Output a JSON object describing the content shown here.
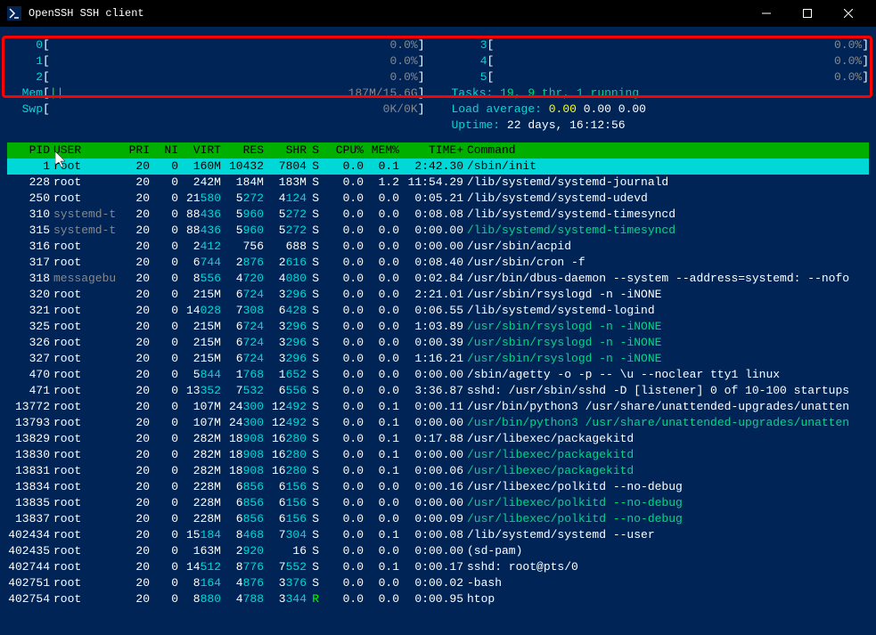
{
  "window": {
    "title": "OpenSSH SSH client"
  },
  "cpu_meters_left": [
    {
      "idx": "0",
      "pct": "0.0%"
    },
    {
      "idx": "1",
      "pct": "0.0%"
    },
    {
      "idx": "2",
      "pct": "0.0%"
    }
  ],
  "cpu_meters_right": [
    {
      "idx": "3",
      "pct": "0.0%"
    },
    {
      "idx": "4",
      "pct": "0.0%"
    },
    {
      "idx": "5",
      "pct": "0.0%"
    }
  ],
  "mem": {
    "label": "Mem",
    "fill": "||",
    "value": "187M/15.6G"
  },
  "swp": {
    "label": "Swp",
    "value": "0K/0K"
  },
  "tasks": {
    "label": "Tasks: ",
    "values": "19, 9 thr, 1 running"
  },
  "load": {
    "label": "Load average: ",
    "v1": "0.00",
    "v2": "0.00",
    "v3": "0.00"
  },
  "uptime": {
    "label": "Uptime: ",
    "value": "22 days, 16:12:56"
  },
  "headers": {
    "pid": "PID",
    "user": "USER",
    "pri": "PRI",
    "ni": "NI",
    "virt": "VIRT",
    "res": "RES",
    "shr": "SHR",
    "s": "S",
    "cpu": "CPU%",
    "mem": "MEM%",
    "time": "TIME+",
    "cmd": "Command"
  },
  "processes": [
    {
      "pid": "1",
      "user": "root",
      "pri": "20",
      "ni": "0",
      "virt": "160M",
      "res": "10432",
      "shr": "7804",
      "s": "S",
      "cpu": "0.0",
      "mem": "0.1",
      "time": "2:42.30",
      "cmd": "/sbin/init",
      "sel": true
    },
    {
      "pid": "228",
      "user": "root",
      "pri": "20",
      "ni": "0",
      "virt": "242M",
      "res": "184M",
      "shr": "183M",
      "s": "S",
      "cpu": "0.0",
      "mem": "1.2",
      "time": "11:54.29",
      "cmd": "/lib/systemd/systemd-journald"
    },
    {
      "pid": "250",
      "user": "root",
      "pri": "20",
      "ni": "0",
      "virt": "21580",
      "res": "5272",
      "shr": "4124",
      "s": "S",
      "cpu": "0.0",
      "mem": "0.0",
      "time": "0:05.21",
      "cmd": "/lib/systemd/systemd-udevd"
    },
    {
      "pid": "310",
      "user": "systemd-t",
      "dimuser": true,
      "pri": "20",
      "ni": "0",
      "virt": "88436",
      "res": "5960",
      "shr": "5272",
      "s": "S",
      "cpu": "0.0",
      "mem": "0.0",
      "time": "0:08.08",
      "cmd": "/lib/systemd/systemd-timesyncd"
    },
    {
      "pid": "315",
      "user": "systemd-t",
      "dimuser": true,
      "pri": "20",
      "ni": "0",
      "virt": "88436",
      "res": "5960",
      "shr": "5272",
      "s": "S",
      "cpu": "0.0",
      "mem": "0.0",
      "time": "0:00.00",
      "cmd": "/lib/systemd/systemd-timesyncd",
      "cmddim": true
    },
    {
      "pid": "316",
      "user": "root",
      "pri": "20",
      "ni": "0",
      "virt": "2412",
      "res": "756",
      "shr": "688",
      "s": "S",
      "cpu": "0.0",
      "mem": "0.0",
      "time": "0:00.00",
      "cmd": "/usr/sbin/acpid"
    },
    {
      "pid": "317",
      "user": "root",
      "pri": "20",
      "ni": "0",
      "virt": "6744",
      "res": "2876",
      "shr": "2616",
      "s": "S",
      "cpu": "0.0",
      "mem": "0.0",
      "time": "0:08.40",
      "cmd": "/usr/sbin/cron -f"
    },
    {
      "pid": "318",
      "user": "messagebu",
      "dimuser": true,
      "pri": "20",
      "ni": "0",
      "virt": "8556",
      "res": "4720",
      "shr": "4080",
      "s": "S",
      "cpu": "0.0",
      "mem": "0.0",
      "time": "0:02.84",
      "cmd": "/usr/bin/dbus-daemon --system --address=systemd: --nofo"
    },
    {
      "pid": "320",
      "user": "root",
      "pri": "20",
      "ni": "0",
      "virt": "215M",
      "res": "6724",
      "shr": "3296",
      "s": "S",
      "cpu": "0.0",
      "mem": "0.0",
      "time": "2:21.01",
      "cmd": "/usr/sbin/rsyslogd -n -iNONE"
    },
    {
      "pid": "321",
      "user": "root",
      "pri": "20",
      "ni": "0",
      "virt": "14028",
      "res": "7308",
      "shr": "6428",
      "s": "S",
      "cpu": "0.0",
      "mem": "0.0",
      "time": "0:06.55",
      "cmd": "/lib/systemd/systemd-logind"
    },
    {
      "pid": "325",
      "user": "root",
      "pri": "20",
      "ni": "0",
      "virt": "215M",
      "res": "6724",
      "shr": "3296",
      "s": "S",
      "cpu": "0.0",
      "mem": "0.0",
      "time": "1:03.89",
      "cmd": "/usr/sbin/rsyslogd -n -iNONE",
      "cmddim": true
    },
    {
      "pid": "326",
      "user": "root",
      "pri": "20",
      "ni": "0",
      "virt": "215M",
      "res": "6724",
      "shr": "3296",
      "s": "S",
      "cpu": "0.0",
      "mem": "0.0",
      "time": "0:00.39",
      "cmd": "/usr/sbin/rsyslogd -n -iNONE",
      "cmddim": true
    },
    {
      "pid": "327",
      "user": "root",
      "pri": "20",
      "ni": "0",
      "virt": "215M",
      "res": "6724",
      "shr": "3296",
      "s": "S",
      "cpu": "0.0",
      "mem": "0.0",
      "time": "1:16.21",
      "cmd": "/usr/sbin/rsyslogd -n -iNONE",
      "cmddim": true
    },
    {
      "pid": "470",
      "user": "root",
      "pri": "20",
      "ni": "0",
      "virt": "5844",
      "res": "1768",
      "shr": "1652",
      "s": "S",
      "cpu": "0.0",
      "mem": "0.0",
      "time": "0:00.00",
      "cmd": "/sbin/agetty -o -p -- \\u --noclear tty1 linux"
    },
    {
      "pid": "471",
      "user": "root",
      "pri": "20",
      "ni": "0",
      "virt": "13352",
      "res": "7532",
      "shr": "6556",
      "s": "S",
      "cpu": "0.0",
      "mem": "0.0",
      "time": "3:36.87",
      "cmd": "sshd: /usr/sbin/sshd -D [listener] 0 of 10-100 startups"
    },
    {
      "pid": "13772",
      "user": "root",
      "pri": "20",
      "ni": "0",
      "virt": "107M",
      "res": "24300",
      "shr": "12492",
      "s": "S",
      "cpu": "0.0",
      "mem": "0.1",
      "time": "0:00.11",
      "cmd": "/usr/bin/python3 /usr/share/unattended-upgrades/unatten"
    },
    {
      "pid": "13793",
      "user": "root",
      "pri": "20",
      "ni": "0",
      "virt": "107M",
      "res": "24300",
      "shr": "12492",
      "s": "S",
      "cpu": "0.0",
      "mem": "0.1",
      "time": "0:00.00",
      "cmd": "/usr/bin/python3 /usr/share/unattended-upgrades/unatten",
      "cmddim": true
    },
    {
      "pid": "13829",
      "user": "root",
      "pri": "20",
      "ni": "0",
      "virt": "282M",
      "res": "18908",
      "shr": "16280",
      "s": "S",
      "cpu": "0.0",
      "mem": "0.1",
      "time": "0:17.88",
      "cmd": "/usr/libexec/packagekitd"
    },
    {
      "pid": "13830",
      "user": "root",
      "pri": "20",
      "ni": "0",
      "virt": "282M",
      "res": "18908",
      "shr": "16280",
      "s": "S",
      "cpu": "0.0",
      "mem": "0.1",
      "time": "0:00.00",
      "cmd": "/usr/libexec/packagekitd",
      "cmddim": true
    },
    {
      "pid": "13831",
      "user": "root",
      "pri": "20",
      "ni": "0",
      "virt": "282M",
      "res": "18908",
      "shr": "16280",
      "s": "S",
      "cpu": "0.0",
      "mem": "0.1",
      "time": "0:00.06",
      "cmd": "/usr/libexec/packagekitd",
      "cmddim": true
    },
    {
      "pid": "13834",
      "user": "root",
      "pri": "20",
      "ni": "0",
      "virt": "228M",
      "res": "6856",
      "shr": "6156",
      "s": "S",
      "cpu": "0.0",
      "mem": "0.0",
      "time": "0:00.16",
      "cmd": "/usr/libexec/polkitd --no-debug"
    },
    {
      "pid": "13835",
      "user": "root",
      "pri": "20",
      "ni": "0",
      "virt": "228M",
      "res": "6856",
      "shr": "6156",
      "s": "S",
      "cpu": "0.0",
      "mem": "0.0",
      "time": "0:00.00",
      "cmd": "/usr/libexec/polkitd --no-debug",
      "cmddim": true
    },
    {
      "pid": "13837",
      "user": "root",
      "pri": "20",
      "ni": "0",
      "virt": "228M",
      "res": "6856",
      "shr": "6156",
      "s": "S",
      "cpu": "0.0",
      "mem": "0.0",
      "time": "0:00.09",
      "cmd": "/usr/libexec/polkitd --no-debug",
      "cmddim": true
    },
    {
      "pid": "402434",
      "user": "root",
      "pri": "20",
      "ni": "0",
      "virt": "15184",
      "res": "8468",
      "shr": "7304",
      "s": "S",
      "cpu": "0.0",
      "mem": "0.1",
      "time": "0:00.08",
      "cmd": "/lib/systemd/systemd --user"
    },
    {
      "pid": "402435",
      "user": "root",
      "pri": "20",
      "ni": "0",
      "virt": "163M",
      "res": "2920",
      "shr": "16",
      "s": "S",
      "cpu": "0.0",
      "mem": "0.0",
      "time": "0:00.00",
      "cmd": "(sd-pam)"
    },
    {
      "pid": "402744",
      "user": "root",
      "pri": "20",
      "ni": "0",
      "virt": "14512",
      "res": "8776",
      "shr": "7552",
      "s": "S",
      "cpu": "0.0",
      "mem": "0.1",
      "time": "0:00.17",
      "cmd": "sshd: root@pts/0"
    },
    {
      "pid": "402751",
      "user": "root",
      "pri": "20",
      "ni": "0",
      "virt": "8164",
      "res": "4876",
      "shr": "3376",
      "s": "S",
      "cpu": "0.0",
      "mem": "0.0",
      "time": "0:00.02",
      "cmd": "-bash"
    },
    {
      "pid": "402754",
      "user": "root",
      "pri": "20",
      "ni": "0",
      "virt": "8880",
      "res": "4788",
      "shr": "3344",
      "s": "R",
      "cpu": "0.0",
      "mem": "0.0",
      "time": "0:00.95",
      "cmd": "htop"
    }
  ]
}
